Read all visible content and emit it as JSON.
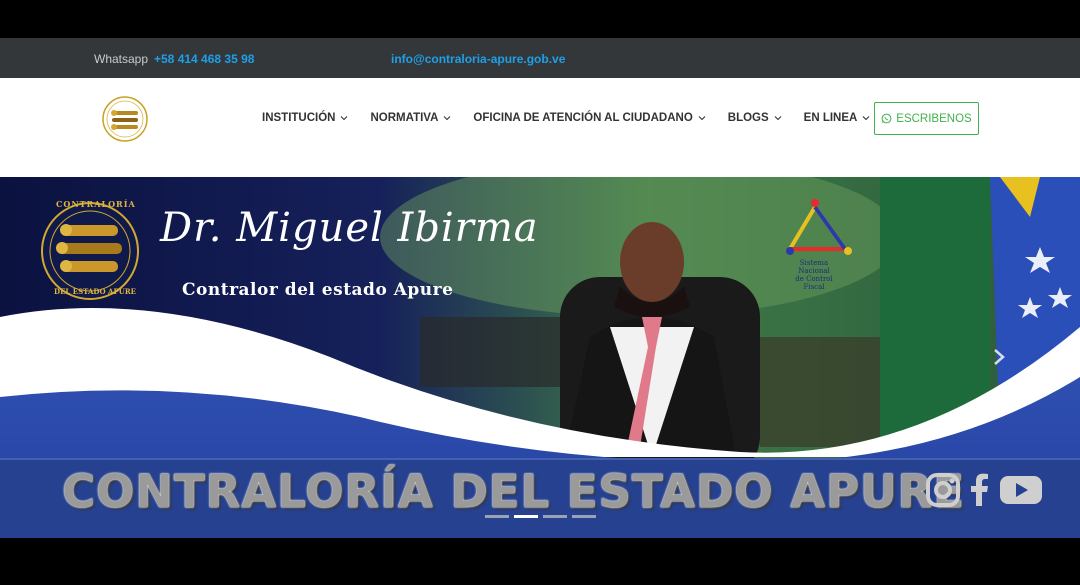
{
  "topbar": {
    "whatsapp_label": "Whatsapp",
    "whatsapp_number": "+58 414 468 35 98",
    "email": "info@contraloria-apure.gob.ve"
  },
  "nav": {
    "items": [
      {
        "label": "INSTITUCIÓN"
      },
      {
        "label": "NORMATIVA"
      },
      {
        "label": "OFICINA DE ATENCIÓN AL CIUDADANO"
      },
      {
        "label": "BLOGS"
      },
      {
        "label": "EN LINEA"
      }
    ],
    "cta_label": "ESCRIBENOS"
  },
  "hero": {
    "name": "Dr. Miguel Ibirma",
    "role": "Contralor del estado Apure",
    "seal_top": "CONTRALORÍA",
    "seal_bottom": "DEL ESTADO APURE",
    "snc_line1": "Sistema Nacional",
    "snc_line2": "de Control Fiscal",
    "banner_title": "CONTRALORÍA DEL ESTADO APURE",
    "slides": [
      false,
      true,
      false,
      false
    ]
  },
  "colors": {
    "accent_blue": "#1ea0e8",
    "cta_green": "#3fb24b",
    "topbar_bg": "#33373a"
  }
}
